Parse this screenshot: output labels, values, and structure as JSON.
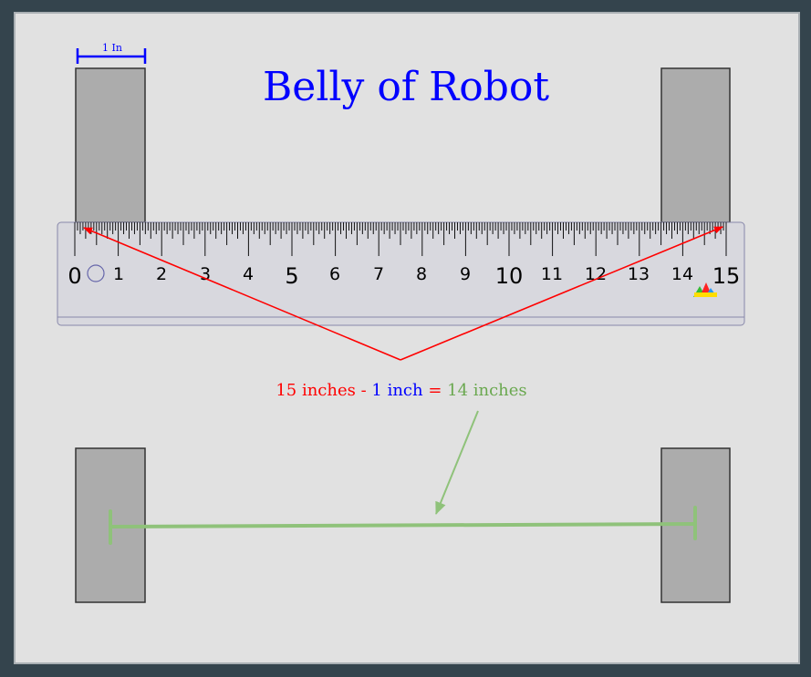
{
  "title": "Belly of Robot",
  "scale_label": "1 In",
  "ruler": {
    "numbers": [
      "0",
      "1",
      "2",
      "3",
      "4",
      "5",
      "6",
      "7",
      "8",
      "9",
      "10",
      "11",
      "12",
      "13",
      "14",
      "15"
    ]
  },
  "equation": {
    "part1": "15 inches",
    "op1": " - ",
    "part2": "1 inch",
    "op2": " = ",
    "part3": "14 inches"
  },
  "colors": {
    "background": "#34444d",
    "panel": "#e1e1e1",
    "wheel": "#acacac",
    "ruler": "#d8d8de",
    "title": "#0000ff",
    "red": "#ff0000",
    "blue": "#0000ff",
    "green": "#8fc27a",
    "green_text": "#6aa84f"
  },
  "icons": [
    "ruler-logo-icon"
  ]
}
